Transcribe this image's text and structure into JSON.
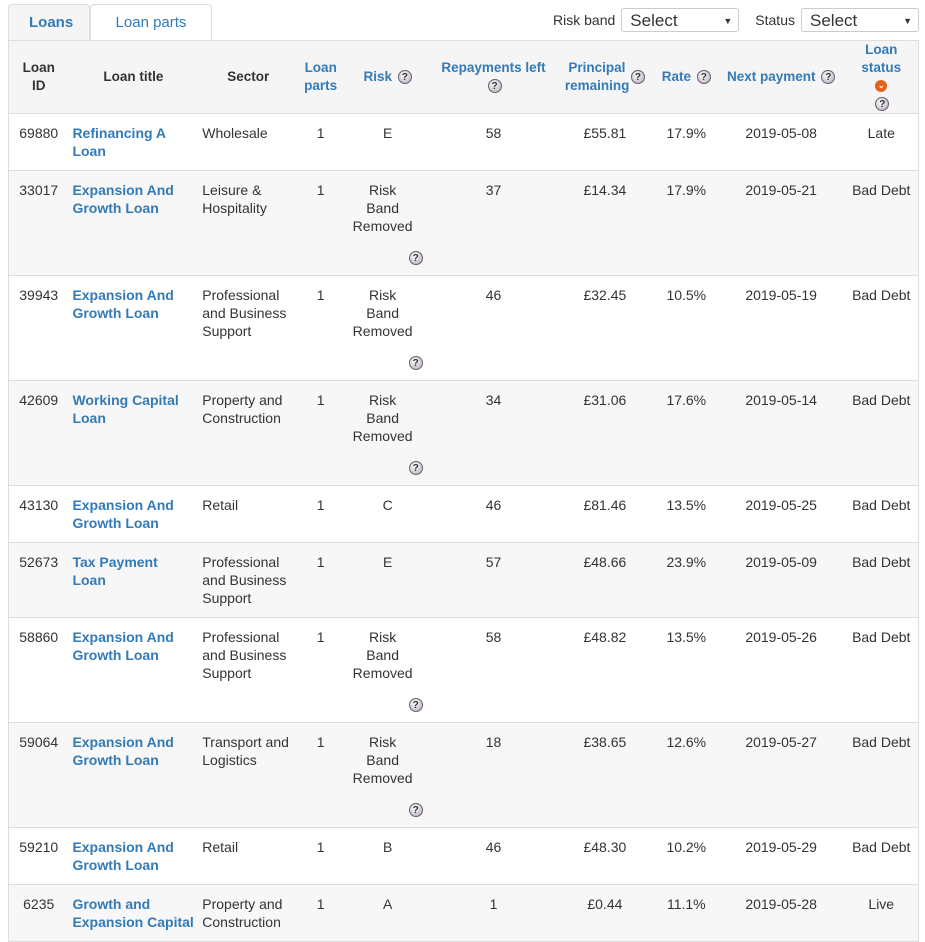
{
  "tabs": [
    {
      "label": "Loans",
      "active": true
    },
    {
      "label": "Loan parts",
      "active": false
    }
  ],
  "filters": {
    "risk_band_label": "Risk band",
    "risk_band_value": "Select",
    "status_label": "Status",
    "status_value": "Select"
  },
  "columns": {
    "loan_id": "Loan ID",
    "loan_title": "Loan title",
    "sector": "Sector",
    "loan_parts": "Loan parts",
    "risk": "Risk",
    "repayments_left": "Repayments left",
    "principal_remaining": "Principal remaining",
    "rate": "Rate",
    "next_payment": "Next payment",
    "loan_status": "Loan status"
  },
  "rows": [
    {
      "id": "69880",
      "title": "Refinancing A Loan",
      "sector": "Wholesale",
      "parts": "1",
      "risk": "E",
      "removed": false,
      "repayments": "58",
      "principal": "£55.81",
      "rate": "17.9%",
      "next": "2019-05-08",
      "status": "Late"
    },
    {
      "id": "33017",
      "title": "Expansion And Growth Loan",
      "sector": "Leisure & Hospitality",
      "parts": "1",
      "risk": "Risk Band Removed",
      "removed": true,
      "repayments": "37",
      "principal": "£14.34",
      "rate": "17.9%",
      "next": "2019-05-21",
      "status": "Bad Debt"
    },
    {
      "id": "39943",
      "title": "Expansion And Growth Loan",
      "sector": "Professional and Business Support",
      "parts": "1",
      "risk": "Risk Band Removed",
      "removed": true,
      "repayments": "46",
      "principal": "£32.45",
      "rate": "10.5%",
      "next": "2019-05-19",
      "status": "Bad Debt"
    },
    {
      "id": "42609",
      "title": "Working Capital Loan",
      "sector": "Property and Construction",
      "parts": "1",
      "risk": "Risk Band Removed",
      "removed": true,
      "repayments": "34",
      "principal": "£31.06",
      "rate": "17.6%",
      "next": "2019-05-14",
      "status": "Bad Debt"
    },
    {
      "id": "43130",
      "title": "Expansion And Growth Loan",
      "sector": "Retail",
      "parts": "1",
      "risk": "C",
      "removed": false,
      "repayments": "46",
      "principal": "£81.46",
      "rate": "13.5%",
      "next": "2019-05-25",
      "status": "Bad Debt"
    },
    {
      "id": "52673",
      "title": "Tax Payment Loan",
      "sector": "Professional and Business Support",
      "parts": "1",
      "risk": "E",
      "removed": false,
      "repayments": "57",
      "principal": "£48.66",
      "rate": "23.9%",
      "next": "2019-05-09",
      "status": "Bad Debt"
    },
    {
      "id": "58860",
      "title": "Expansion And Growth Loan",
      "sector": "Professional and Business Support",
      "parts": "1",
      "risk": "Risk Band Removed",
      "removed": true,
      "repayments": "58",
      "principal": "£48.82",
      "rate": "13.5%",
      "next": "2019-05-26",
      "status": "Bad Debt"
    },
    {
      "id": "59064",
      "title": "Expansion And Growth Loan",
      "sector": "Transport and Logistics",
      "parts": "1",
      "risk": "Risk Band Removed",
      "removed": true,
      "repayments": "18",
      "principal": "£38.65",
      "rate": "12.6%",
      "next": "2019-05-27",
      "status": "Bad Debt"
    },
    {
      "id": "59210",
      "title": "Expansion And Growth Loan",
      "sector": "Retail",
      "parts": "1",
      "risk": "B",
      "removed": false,
      "repayments": "46",
      "principal": "£48.30",
      "rate": "10.2%",
      "next": "2019-05-29",
      "status": "Bad Debt"
    },
    {
      "id": "6235",
      "title": "Growth and Expansion Capital",
      "sector": "Property and Construction",
      "parts": "1",
      "risk": "A",
      "removed": false,
      "repayments": "1",
      "principal": "£0.44",
      "rate": "11.1%",
      "next": "2019-05-28",
      "status": "Live"
    }
  ],
  "icons": {
    "help": "question-circle-icon",
    "sort": "sort-descending-icon",
    "dropdown": "caret-down-icon"
  },
  "colors": {
    "link": "#337ab7",
    "sort_badge": "#e0621d",
    "header_bg": "#f5f5f5"
  }
}
